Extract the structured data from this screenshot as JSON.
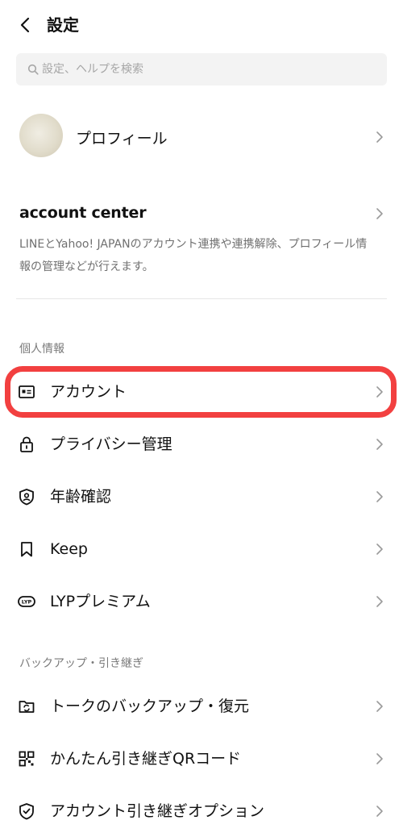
{
  "header": {
    "title": "設定"
  },
  "search": {
    "placeholder": "設定、ヘルプを検索"
  },
  "profile": {
    "label": "プロフィール"
  },
  "account_center": {
    "title": "account center",
    "description": "LINEとYahoo! JAPANのアカウント連携や連携解除、プロフィール情報の管理などが行えます。"
  },
  "sections": {
    "personal": {
      "title": "個人情報",
      "items": [
        {
          "label": "アカウント",
          "icon": "id-card-icon"
        },
        {
          "label": "プライバシー管理",
          "icon": "lock-icon"
        },
        {
          "label": "年齢確認",
          "icon": "shield-person-icon"
        },
        {
          "label": "Keep",
          "icon": "bookmark-icon"
        },
        {
          "label": "LYPプレミアム",
          "icon": "lyp-badge-icon"
        }
      ]
    },
    "backup": {
      "title": "バックアップ・引き継ぎ",
      "items": [
        {
          "label": "トークのバックアップ・復元",
          "icon": "folder-sync-icon"
        },
        {
          "label": "かんたん引き継ぎQRコード",
          "icon": "qr-code-icon"
        },
        {
          "label": "アカウント引き継ぎオプション",
          "icon": "shield-check-icon"
        }
      ]
    }
  },
  "highlight_color": "#f24040"
}
